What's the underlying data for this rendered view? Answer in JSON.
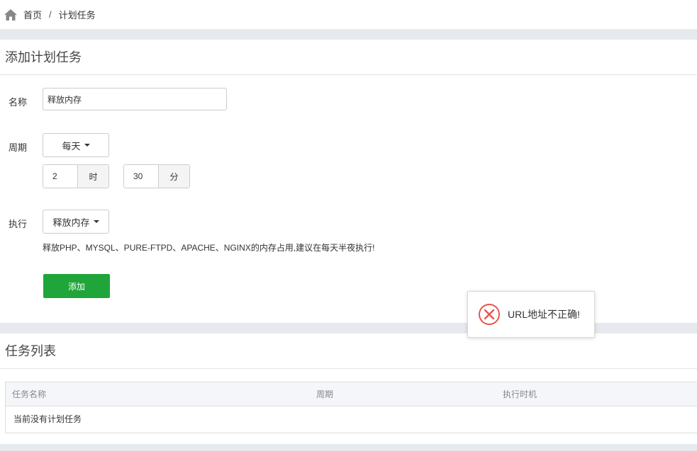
{
  "breadcrumb": {
    "home": "首页",
    "separator": "/",
    "current": "计划任务"
  },
  "add_panel": {
    "title": "添加计划任务",
    "name_label": "名称",
    "name_value": "释放内存",
    "cycle_label": "周期",
    "cycle_value": "每天",
    "hour_value": "2",
    "hour_unit": "时",
    "minute_value": "30",
    "minute_unit": "分",
    "exec_label": "执行",
    "exec_value": "释放内存",
    "hint": "释放PHP、MYSQL、PURE-FTPD、APACHE、NGINX的内存占用,建议在每天半夜执行!",
    "add_button": "添加"
  },
  "list_panel": {
    "title": "任务列表",
    "columns": [
      "任务名称",
      "周期",
      "执行时机"
    ],
    "empty_text": "当前没有计划任务"
  },
  "toast": {
    "message": "URL地址不正确!",
    "icon": "error-circle-icon",
    "color": "#e8554e"
  },
  "colors": {
    "primary": "#20a53a",
    "background": "#e6e9ed"
  }
}
